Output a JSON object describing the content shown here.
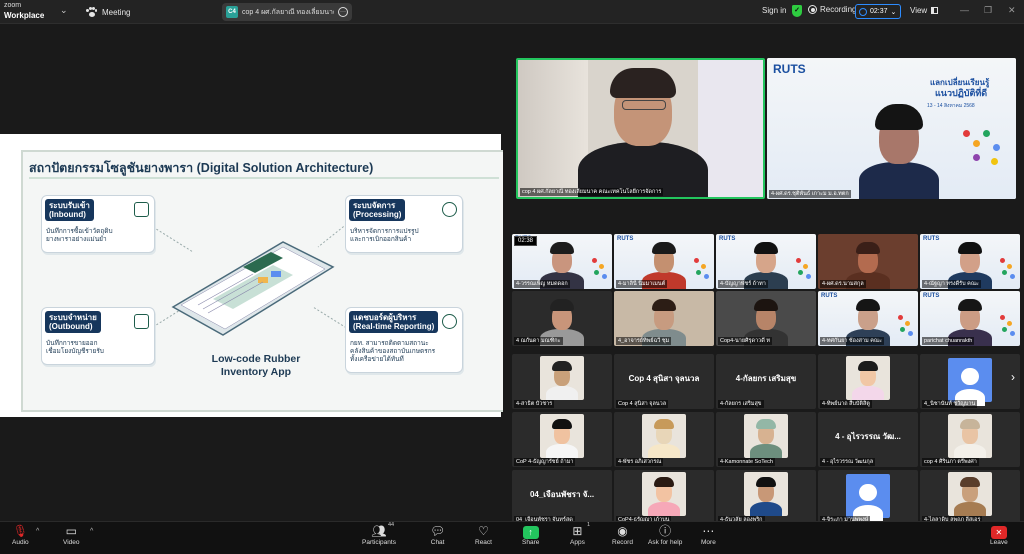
{
  "titlebar": {
    "app_name_line1": "zoom",
    "app_name_line2": "Workplace",
    "meeting_label": "Meeting",
    "tab_avatar": "C4",
    "tab_title": "cop 4 ผศ.กัลยาณี  ทองเลี่ยมนาค  คณะบ",
    "sign_in": "Sign in",
    "recording_label": "Recording",
    "timer": "02:37",
    "view_label": "View"
  },
  "slide": {
    "title": "สถาปัตยกรรมโซลูชันยางพารา (Digital Solution Architecture)",
    "inbound": {
      "head": [
        "ระบบรับเข้า",
        "(Inbound)"
      ],
      "body": [
        "บันทึกการซื้อเข้าวัตถุดิบ",
        "ยางพาราอย่างแม่นยำ"
      ]
    },
    "processing": {
      "head": [
        "ระบบจัดการ",
        "(Processing)"
      ],
      "body": [
        "บริหารจัดการการแปรรูป",
        "และการเบิกออกสินค้า"
      ]
    },
    "outbound": {
      "head": [
        "ระบบจำหน่าย",
        "(Outbound)"
      ],
      "body": [
        "บันทึกการขายออก",
        "เชื่อมโยงบัญชีรายรับ"
      ]
    },
    "reporting": {
      "head": [
        "แดชบอร์ดผู้บริหาร",
        "(Real-time Reporting)"
      ],
      "body": [
        "กยท. สามารถติดตามสถานะ",
        "คลังสินค้าของสถาบันเกษตรกร",
        "ทั้งเครือข่ายได้ทันที"
      ]
    },
    "app_title": [
      "Low-code Rubber",
      "Inventory App"
    ]
  },
  "speakers": [
    {
      "name": "cop 4 ผศ.กัลยาณี  ทองเลี่ยมนาค  คณะเทคโนโลยีการจัดการ"
    },
    {
      "name": "4-ผศ.ดร.ชุติพันธ์  เกาะม ม.อ.ทตก"
    }
  ],
  "poster_text": [
    "RUTS",
    "แลกเปลี่ยนเรียนรู้",
    "แนวปฏิบัติที่ดี",
    "13 - 14 สิงหาคม 2568"
  ],
  "tile_timer": "02:38",
  "gallery": [
    {
      "name": "4-วรรณเพ็ญ  หมดดอก"
    },
    {
      "name": "4-มาลินี  นิ่มมาเมนต์"
    },
    {
      "name": "4-บัญญาพัชร์ ถ้าทา"
    },
    {
      "name": "4-ผศ.ดร.นามสกุล"
    },
    {
      "name": "4-ณัฐญา ทรงดีรับ คณะ"
    },
    {
      "name": "4 ณกันดา มณฑิกะ"
    },
    {
      "name": "4_อาจารย์ทิพย์ฉวี ชุม"
    },
    {
      "name": "Cop4-นายศิรุดาวดี  ท"
    },
    {
      "name": "4-ทศกันยา ช้องสาม คณะ"
    },
    {
      "name": "parichat chuanrakth"
    },
    {
      "name": "4-สาธิต บัวชาร"
    },
    {
      "name": "Cop 4 สุนิสา จุลนวล",
      "center": "Cop 4 สุนิสา จุลนวล"
    },
    {
      "name": "4-กัลยกร เสริมสุข",
      "center": "4-กัลยกร เสริมสุข"
    },
    {
      "name": "4-ทิพย์นาถ สืบบัติสิตู"
    },
    {
      "name": "4_นิชานันท์ ชวัญบาน"
    },
    {
      "name": "CoP 4-ธัญญารัชย์ ถ้ามา"
    },
    {
      "name": "4-พัชร อภิเสวกรณ"
    },
    {
      "name": "4-Kamonnate SoTech"
    },
    {
      "name": "4 - อุไรวรรณ วัฒนกุล",
      "center": "4 - อุไรวรรณ วัฒ..."
    },
    {
      "name": "cop 4 ศิรินภา ตรีพงศา"
    },
    {
      "name": "04_เจือนพัชรา จันทร์สด",
      "center": "04_เจือนพัชรา จั..."
    },
    {
      "name": "CoP4-ธรัญญา เก้าบน"
    },
    {
      "name": "4-ธันวลัย ลองพริก"
    },
    {
      "name": "4-จิระภา มานพพงษ์"
    },
    {
      "name": "4-ไลลาดิบ ลพฤภ ลีสเอร"
    }
  ],
  "toolbar": {
    "audio": "Audio",
    "video": "Video",
    "participants": "Participants",
    "participants_count": "44",
    "chat": "Chat",
    "react": "React",
    "share": "Share",
    "apps": "Apps",
    "apps_count": "1",
    "record": "Record",
    "help": "Ask for help",
    "more": "More",
    "leave": "Leave"
  }
}
